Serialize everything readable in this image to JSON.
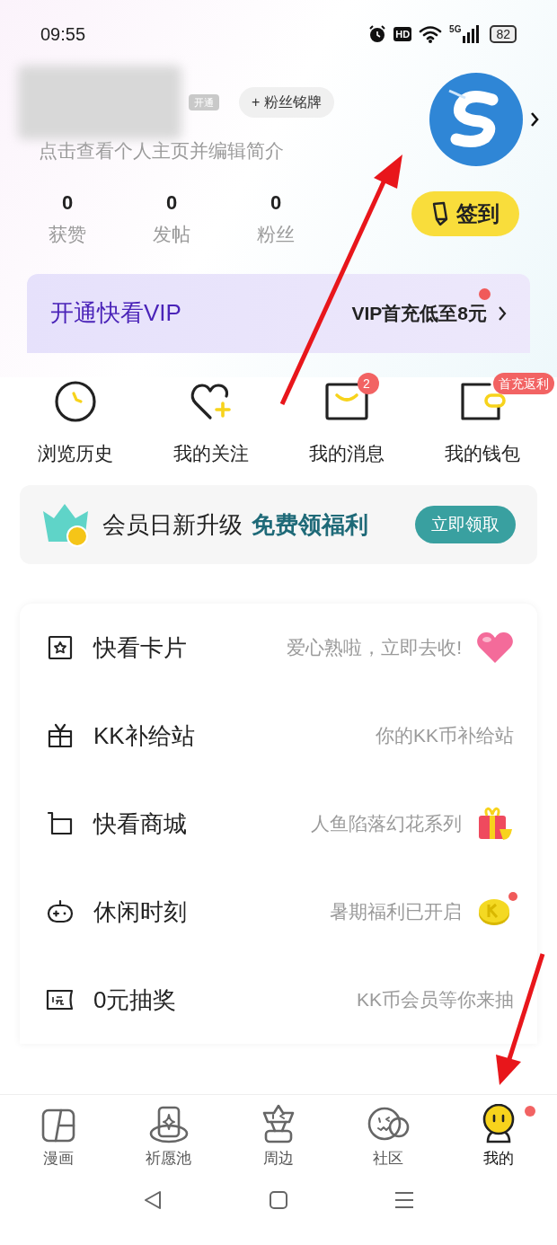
{
  "status_bar": {
    "time": "09:55",
    "hd": "HD",
    "network": "5G",
    "battery": "82"
  },
  "profile": {
    "vip_tag": "开通",
    "fan_badge": "+ 粉丝铭牌",
    "subtitle": "点击查看个人主页并编辑简介",
    "stats": [
      {
        "value": "0",
        "label": "获赞"
      },
      {
        "value": "0",
        "label": "发帖"
      },
      {
        "value": "0",
        "label": "粉丝"
      }
    ],
    "checkin": "签到"
  },
  "vip_banner": {
    "title": "开通快看VIP",
    "offer": "VIP首充低至8元",
    "dot": true
  },
  "shortcuts": [
    {
      "kind": "clock",
      "label": "浏览历史"
    },
    {
      "kind": "heart",
      "label": "我的关注"
    },
    {
      "kind": "message",
      "label": "我的消息",
      "badge": "2"
    },
    {
      "kind": "wallet",
      "label": "我的钱包",
      "badge": "首充返利"
    }
  ],
  "member_bar": {
    "text": "会员日新升级",
    "highlight": "免费领福利",
    "button": "立即领取"
  },
  "menu": [
    {
      "kind": "card",
      "title": "快看卡片",
      "hint": "爱心熟啦，立即去收!",
      "extra": {
        "kind": "heart"
      },
      "dot": false
    },
    {
      "kind": "gift",
      "title": "KK补给站",
      "hint": "你的KK币补给站",
      "dot": false
    },
    {
      "kind": "cart",
      "title": "快看商城",
      "hint": "人鱼陷落幻花系列",
      "extra": {
        "kind": "present"
      },
      "dot": false
    },
    {
      "kind": "game",
      "title": "休闲时刻",
      "hint": "暑期福利已开启",
      "extra": {
        "kind": "coin"
      },
      "dot": true
    },
    {
      "kind": "ticket",
      "title": "0元抽奖",
      "hint": "KK币会员等你来抽",
      "dot": false
    }
  ],
  "tabs": [
    {
      "kind": "comic",
      "label": "漫画",
      "selected": false,
      "dot": false
    },
    {
      "kind": "wish",
      "label": "祈愿池",
      "selected": false,
      "dot": false
    },
    {
      "kind": "ip",
      "label": "周边",
      "selected": false,
      "dot": false
    },
    {
      "kind": "community",
      "label": "社区",
      "selected": false,
      "dot": false
    },
    {
      "kind": "me",
      "label": "我的",
      "selected": true,
      "dot": true
    }
  ]
}
